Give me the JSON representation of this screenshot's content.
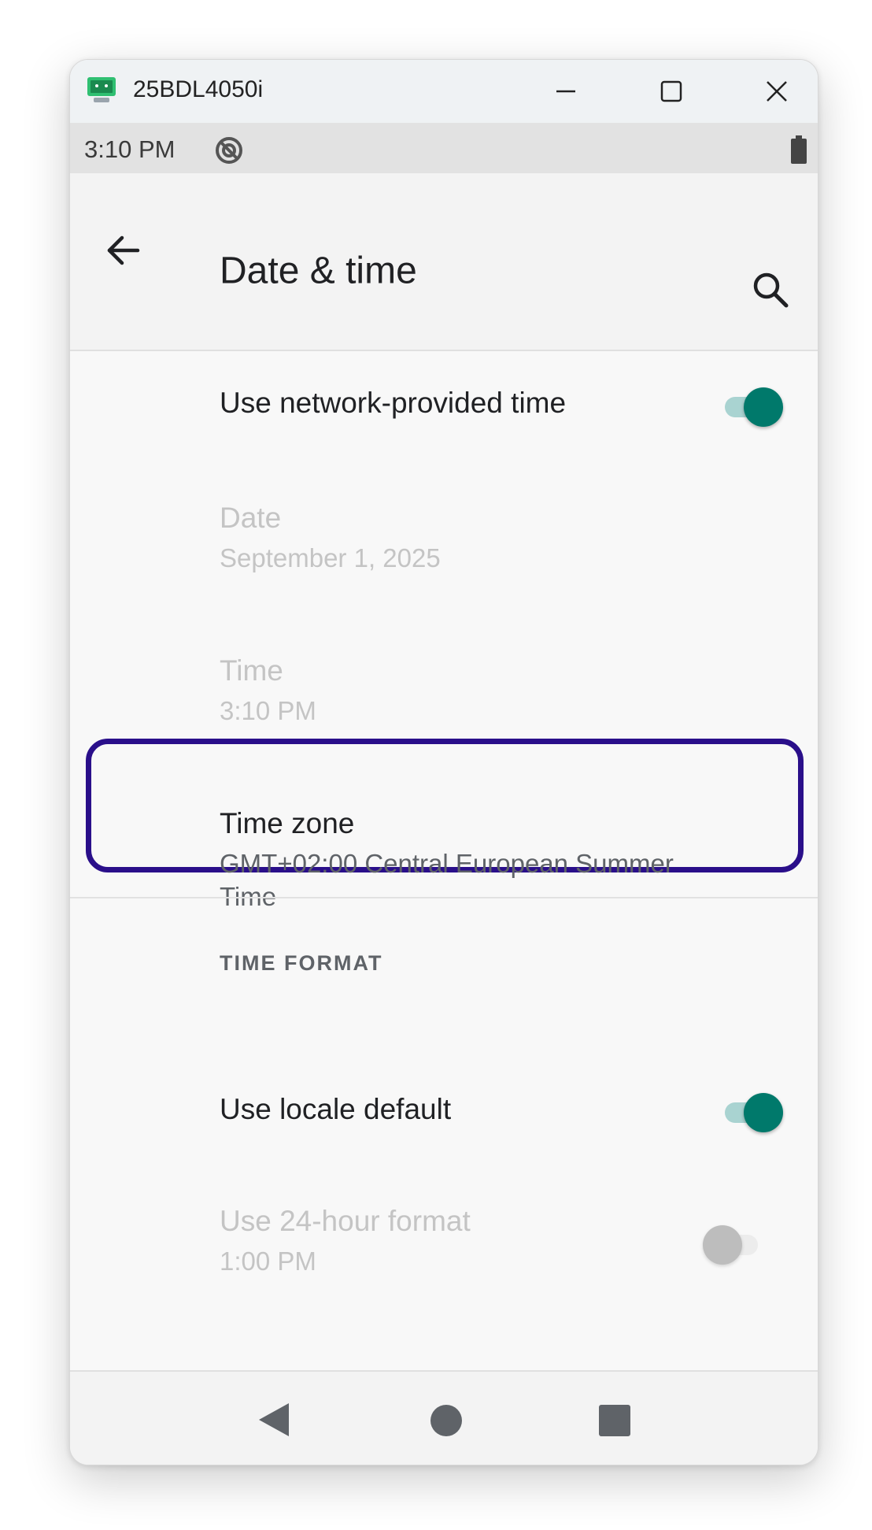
{
  "window": {
    "title": "25BDL4050i"
  },
  "status_bar": {
    "time": "3:10 PM"
  },
  "app_bar": {
    "title": "Date & time"
  },
  "settings": {
    "network_time": {
      "title": "Use network-provided time",
      "enabled": true
    },
    "date": {
      "title": "Date",
      "summary": "September 1, 2025"
    },
    "time": {
      "title": "Time",
      "summary": "3:10 PM"
    },
    "time_zone": {
      "title": "Time zone",
      "summary": "GMT+02:00 Central European Summer Time"
    },
    "time_format_header": "TIME FORMAT",
    "locale_default": {
      "title": "Use locale default",
      "enabled": true
    },
    "hour24": {
      "title": "Use 24-hour format",
      "summary": "1:00 PM",
      "enabled": false
    }
  },
  "colors": {
    "accent": "#00796b",
    "highlight": "#2a0f8a"
  },
  "icons": {
    "app": "android-emulator-icon",
    "back": "arrow-back-icon",
    "search": "search-icon",
    "sync": "sync-icon",
    "battery": "battery-icon",
    "nav_back": "nav-back-triangle-icon",
    "nav_home": "nav-home-circle-icon",
    "nav_recent": "nav-recents-square-icon"
  }
}
